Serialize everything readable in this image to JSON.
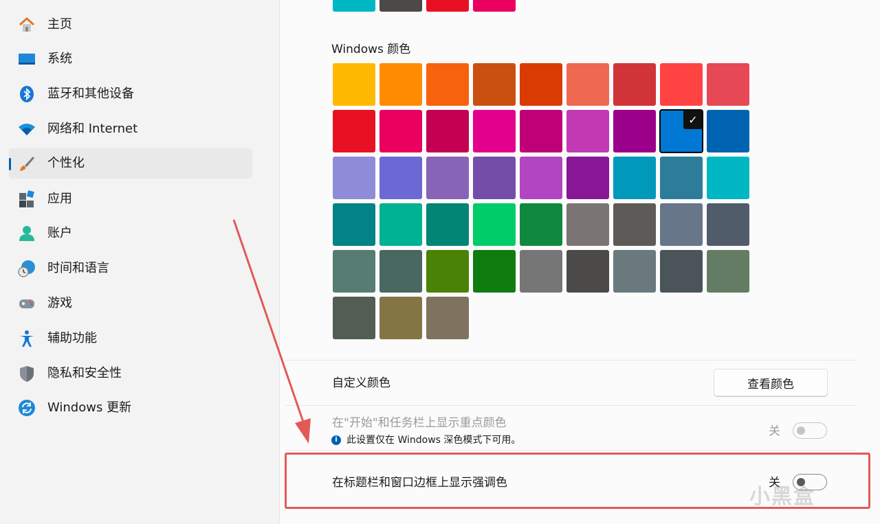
{
  "sidebar": {
    "items": [
      {
        "label": "主页",
        "icon": "home-icon"
      },
      {
        "label": "系统",
        "icon": "system-display-icon"
      },
      {
        "label": "蓝牙和其他设备",
        "icon": "bluetooth-icon"
      },
      {
        "label": "网络和 Internet",
        "icon": "wifi-icon"
      },
      {
        "label": "个性化",
        "icon": "paintbrush-icon",
        "active": true
      },
      {
        "label": "应用",
        "icon": "apps-icon"
      },
      {
        "label": "账户",
        "icon": "account-icon"
      },
      {
        "label": "时间和语言",
        "icon": "globe-clock-icon"
      },
      {
        "label": "游戏",
        "icon": "gamepad-icon"
      },
      {
        "label": "辅助功能",
        "icon": "accessibility-icon"
      },
      {
        "label": "隐私和安全性",
        "icon": "shield-icon"
      },
      {
        "label": "Windows 更新",
        "icon": "update-icon"
      }
    ]
  },
  "recent_colors": [
    "#00b7c3",
    "#4c4a48",
    "#e81123",
    "#ea005e"
  ],
  "windows_colors": {
    "title": "Windows 颜色",
    "selected_index": 16,
    "colors": [
      "#ffb900",
      "#ff8c00",
      "#f7630c",
      "#ca5010",
      "#da3b01",
      "#ef6950",
      "#d13438",
      "#ff4343",
      "#e74856",
      "#e81123",
      "#ea005e",
      "#c30052",
      "#e3008c",
      "#bf0077",
      "#c239b3",
      "#9a0089",
      "#0078d4",
      "#0063b1",
      "#8e8cd8",
      "#6b69d6",
      "#8764b8",
      "#744da9",
      "#b146c2",
      "#881798",
      "#0099bc",
      "#2d7d9a",
      "#00b7c3",
      "#038387",
      "#00b294",
      "#018574",
      "#00cc6a",
      "#10893e",
      "#7a7574",
      "#5d5a58",
      "#68768a",
      "#515c6b",
      "#567c73",
      "#486860",
      "#498205",
      "#107c10",
      "#767676",
      "#4c4a48",
      "#69797e",
      "#4a5459",
      "#647c64",
      "#525e54",
      "#847545",
      "#7e735f"
    ]
  },
  "custom_color": {
    "label": "自定义颜色",
    "button_label": "查看颜色"
  },
  "start_taskbar_accent": {
    "label": "在\"开始\"和任务栏上显示重点颜色",
    "note": "此设置仅在 Windows 深色模式下可用。",
    "state_label": "关",
    "enabled": false,
    "disabled": true
  },
  "titlebar_accent": {
    "label": "在标题栏和窗口边框上显示强调色",
    "state_label": "关",
    "enabled": false
  },
  "watermark": "小黑盒",
  "colors": {
    "accent": "#005fb8",
    "annotation_red": "#e25a55"
  }
}
